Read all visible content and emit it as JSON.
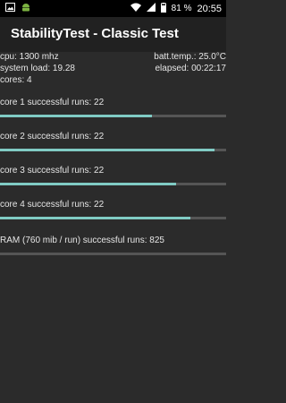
{
  "status_bar": {
    "left_icons": [
      "image-icon",
      "android-icon"
    ],
    "battery_percent": "81 %",
    "time": "20:55"
  },
  "app_bar": {
    "title": "StabilityTest - Classic Test"
  },
  "info": {
    "cpu": "cpu: 1300 mhz",
    "batt_temp": "batt.temp.: 25.0°C",
    "system_load": "system load: 19.28",
    "elapsed": "elapsed: 00:22:17",
    "cores": "cores: 4"
  },
  "tests": [
    {
      "label": "core 1 successful runs: 22",
      "progress": 0.67
    },
    {
      "label": "core 2 successful runs: 22",
      "progress": 0.95
    },
    {
      "label": "core 3 successful runs: 22",
      "progress": 0.78
    },
    {
      "label": "core 4 successful runs: 22",
      "progress": 0.84
    },
    {
      "label": "RAM (760 mib / run) successful runs: 825",
      "progress": 0.0
    }
  ],
  "colors": {
    "progress_fill": "#80cbc4",
    "progress_track": "#555555"
  }
}
